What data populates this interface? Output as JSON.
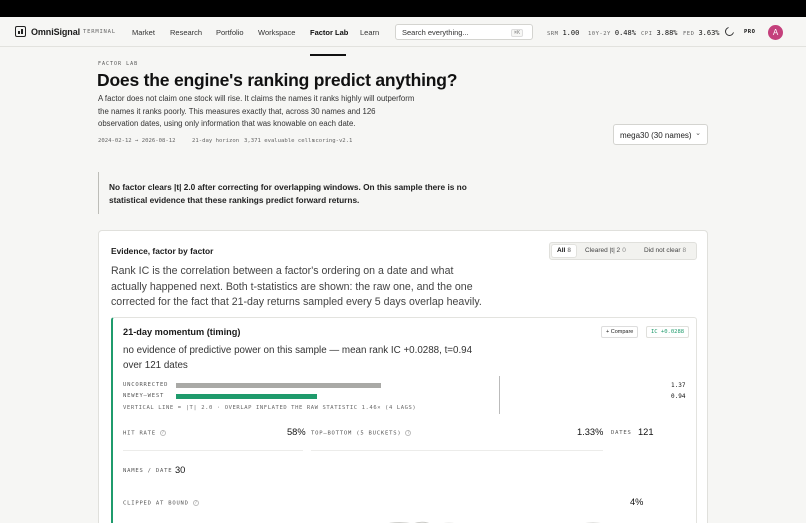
{
  "nav": {
    "brand": "OmniSignal",
    "section_tag": "TERMINAL",
    "links": [
      "Market",
      "Research",
      "Portfolio",
      "Workspace",
      "Factor Lab",
      "Learn"
    ],
    "active_link": "Factor Lab",
    "search_placeholder": "Search everything...",
    "search_shortcut": "⌘K",
    "tickers": [
      {
        "label": "SRM",
        "value": "1.00"
      },
      {
        "label": "10Y-2Y",
        "value": "0.48%"
      },
      {
        "label": "CPI",
        "value": "3.88%"
      },
      {
        "label": "FED",
        "value": "3.63%"
      }
    ],
    "plan_badge": "PRO",
    "avatar_initial": "A"
  },
  "header": {
    "eyebrow": "FACTOR LAB",
    "title": "Does the engine's ranking predict anything?",
    "lede": "A factor does not claim one stock will rise. It claims the names it ranks highly will outperform the names it ranks poorly. This measures exactly that, across 30 names and 126 observation dates, using only information that was knowable on each date.",
    "meta": {
      "date_range": "2024-02-12 → 2026-08-12",
      "horizon": "21-day horizon",
      "cells": "3,371 evaluable cells",
      "version": "scoring-v2.1"
    },
    "universe_select": "mega30 (30 names)"
  },
  "verdict": "No factor clears |t| 2.0 after correcting for overlapping windows. On this sample there is no statistical evidence that these rankings predict forward returns.",
  "evidence": {
    "title": "Evidence, factor by factor",
    "filters": [
      {
        "label": "All",
        "count": "8"
      },
      {
        "label": "Cleared |t| 2",
        "count": "0"
      },
      {
        "label": "Did not clear",
        "count": "8"
      }
    ],
    "active_filter": "All",
    "description": "Rank IC is the correlation between a factor's ordering on a date and what actually happened next. Both t-statistics are shown: the raw one, and the one corrected for the fact that 21-day returns sampled every 5 days overlap heavily.",
    "factor": {
      "name": "21-day momentum (timing)",
      "compare_label": "+ Compare",
      "ic_badge": "IC +0.0288",
      "verdict": "no evidence of predictive power on this sample — mean rank IC +0.0288, t=0.94 over 121 dates",
      "tstats": [
        {
          "label": "UNCORRECTED",
          "value": "1.37",
          "t": 1.37,
          "color": "#a9a9a6"
        },
        {
          "label": "NEWEY–WEST",
          "value": "0.94",
          "t": 0.94,
          "color": "#1f9b6c"
        }
      ],
      "tstat_scale_max": 2.15,
      "threshold_note": "VERTICAL LINE = |T| 2.0 · OVERLAP INFLATED THE RAW STATISTIC 1.46× (4 LAGS)",
      "stats": {
        "hit_rate_label": "HIT RATE",
        "hit_rate": "58%",
        "spread_label": "TOP–BOTTOM (5 BUCKETS)",
        "spread": "1.33%",
        "dates_label": "DATES",
        "dates": "121",
        "names_label": "NAMES / DATE",
        "names": "30",
        "clipped_label": "CLIPPED AT BOUND",
        "clipped": "4%"
      }
    }
  },
  "colors": {
    "accent": "#1f9b6c",
    "avatar": "#c4407c",
    "uncorrected_bar": "#a9a9a6"
  }
}
